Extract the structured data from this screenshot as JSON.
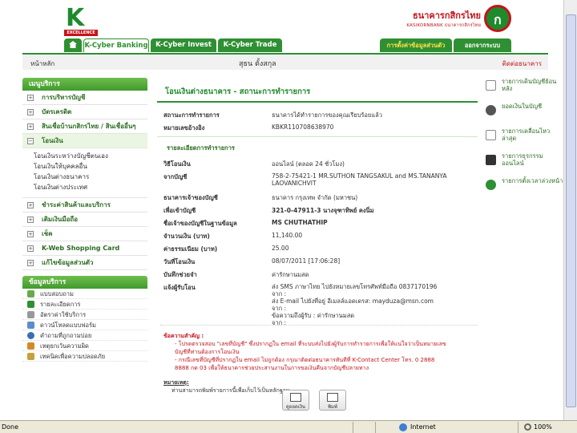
{
  "brand": {
    "logo_letter": "K",
    "logo_sub": "EXCELLENCE",
    "bank_th": "ธนาคารกสิกรไทย",
    "bank_en": "KASIKORNBANK ธนาคารกสิกรไทย",
    "emblem_glyph": "ก"
  },
  "topnav": {
    "tabs": [
      "K-Cyber Banking",
      "K-Cyber Invest",
      "K-Cyber Trade"
    ],
    "security": "การตั้งค่าข้อมูลส่วนตัว",
    "logout": "ออกจากระบบ"
  },
  "crumb": {
    "home": "หน้าหลัก",
    "user": "สุธน ตั้งสกุล",
    "contact": "ติดต่อธนาคาร"
  },
  "sidebar": {
    "head": "เมนูบริการ",
    "items": [
      {
        "label": "การบริหารบัญชี"
      },
      {
        "label": "บัตรเครดิต"
      },
      {
        "label": "สินเชื่อบ้านกสิกรไทย / สินเชื่ออื่นๆ"
      },
      {
        "label": "โอนเงิน"
      },
      {
        "label": "ชำระค่าสินค้าและบริการ"
      },
      {
        "label": "เติมเงินมือถือ"
      },
      {
        "label": "เช็ค"
      },
      {
        "label": "K-Web Shopping Card"
      },
      {
        "label": "แก้ไขข้อมูลส่วนตัว"
      }
    ],
    "transfer_sub": [
      "โอนเงินระหว่างบัญชีตนเอง",
      "โอนเงินให้บุคคลอื่น",
      "โอนเงินต่างธนาคาร",
      "โอนเงินต่างประเทศ"
    ],
    "info_head": "ข้อมูลบริการ",
    "info_items": [
      "แบบสอบถาม",
      "รายละเอียดการ",
      "อัตราค่าใช้บริการ",
      "ดาวน์โหลดแบบฟอร์ม",
      "คำถามที่ถูกถามบ่อย",
      "เหตุยกเว้นความผิด",
      "เทคนิคเพื่อความปลอดภัย"
    ]
  },
  "main": {
    "title": "โอนเงินต่างธนาคาร - สถานะการทำรายการ",
    "status_label": "สถานะการทำรายการ",
    "status_value": "ธนาคารได้ทำรายการของคุณเรียบร้อยแล้ว",
    "ref_label": "หมายเลขอ้างอิง",
    "ref_value": "KBKR110708638970",
    "section": "รายละเอียดการทำรายการ",
    "method_label": "วิธีโอนเงิน",
    "method_value": "ออนไลน์ (ตลอด 24 ชั่วโมง)",
    "from_label": "จากบัญชี",
    "from_value_1": "758-2-75421-1 MR.SUTHON TANGSAKUL and MS.TANANYA",
    "from_value_2": "LAOVANICHVIT",
    "bank_label": "ธนาคารเจ้าของบัญชี",
    "bank_value": "ธนาคาร กรุงเทพ จำกัด (มหาชน)",
    "to_label": "เพื่อเข้าบัญชี",
    "to_value": "321-0-47911-3 นางจุฑาทิพย์ คงนิ่ม",
    "name_label": "ชื่อเจ้าของบัญชีในฐานข้อมูล",
    "name_value": "MS CHUTHATHIP",
    "amount_label": "จำนวนเงิน (บาท)",
    "amount_value": "11,140.00",
    "fee_label": "ค่าธรรมเนียม (บาท)",
    "fee_value": "25.00",
    "date_label": "วันที่โอนเงิน",
    "date_value": "08/07/2011 [17:06:28]",
    "memo_label": "บันทึกช่วยจำ",
    "memo_value": "ค่ารักษานมสด",
    "notify_label": "แจ้งผู้รับโอน",
    "notify_1": "ส่ง SMS ภาษาไทย ไปยังหมายเลขโทรศัพท์มือถือ 0837170196",
    "notify_2": "จาก :",
    "notify_3": "ส่ง E-mail ไปยังที่อยู่ อีเมลล์แอดเดรส: mayduza@msn.com",
    "notify_4": "จาก :",
    "notify_5": "ข้อความถึงผู้รับ : ค่ารักษานมสด",
    "notify_6": "จาก :",
    "notes_title": "ข้อความสำคัญ :",
    "notes_1": "- โปรดตรวจสอบ \"เลขที่บัญชี\" ซึ่งปรากฏใน email ที่ระบบส่งไปยังผู้รับการทำรายการเพื่อให้แน่ใจว่าเป็นหมายเลข",
    "notes_2": "บัญชีที่ท่านต้องการโอนเงิน",
    "notes_3": "- กรณีเลขที่บัญชีที่ปรากฏใน email ไม่ถูกต้อง กรุณาติดต่อธนาคารทันทีที่ K-Contact Center โทร. 0 2888",
    "notes_4": "8888 กด 03 เพื่อให้ธนาคารช่วยประสานงานในการขอเงินคืนจากบัญชีปลายทาง",
    "remark_title": "หมายเหตุ:",
    "remark_1": "ท่านสามารถพิมพ์รายการนี้เพื่อเก็บไว้เป็นหลักฐาน",
    "btn_balance": "ดูยอดเงิน",
    "btn_print": "พิมพ์"
  },
  "rightlinks": [
    {
      "label": "รายการเดินบัญชีย้อนหลัง",
      "icon": "statement-icon"
    },
    {
      "label": "ยอดเงินในบัญชี",
      "icon": "moneybag-icon"
    },
    {
      "label": "รายการเคลื่อนไหวล่าสุด",
      "icon": "recent-icon"
    },
    {
      "label": "รายการธุรกรรมออนไลน์",
      "icon": "monitor-icon"
    },
    {
      "label": "รายการตั้งเวลาล่วงหน้า",
      "icon": "clock-icon"
    }
  ],
  "statusbar": {
    "done": "Done",
    "zone": "Internet",
    "zoom": "100%"
  }
}
